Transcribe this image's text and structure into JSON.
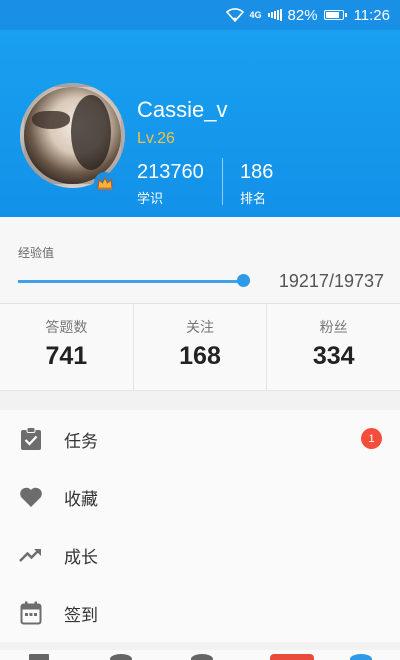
{
  "status_bar": {
    "battery": "82%",
    "time": "11:26",
    "network": "4G"
  },
  "profile": {
    "username": "Cassie_v",
    "level": "Lv.26",
    "stats": [
      {
        "value": "213760",
        "label": "学识"
      },
      {
        "value": "186",
        "label": "排名"
      }
    ]
  },
  "experience": {
    "label": "经验值",
    "value": "19217/19737",
    "progress": 0.974
  },
  "counts": [
    {
      "label": "答题数",
      "value": "741"
    },
    {
      "label": "关注",
      "value": "168"
    },
    {
      "label": "粉丝",
      "value": "334"
    }
  ],
  "menu": [
    {
      "label": "任务",
      "icon": "clipboard-check-icon",
      "badge": "1"
    },
    {
      "label": "收藏",
      "icon": "heart-icon"
    },
    {
      "label": "成长",
      "icon": "trending-up-icon"
    },
    {
      "label": "签到",
      "icon": "calendar-icon"
    }
  ],
  "colors": {
    "header": "#1a9bef",
    "accent": "#2e9ae8",
    "level": "#f5c043",
    "badge": "#f24e3b"
  }
}
